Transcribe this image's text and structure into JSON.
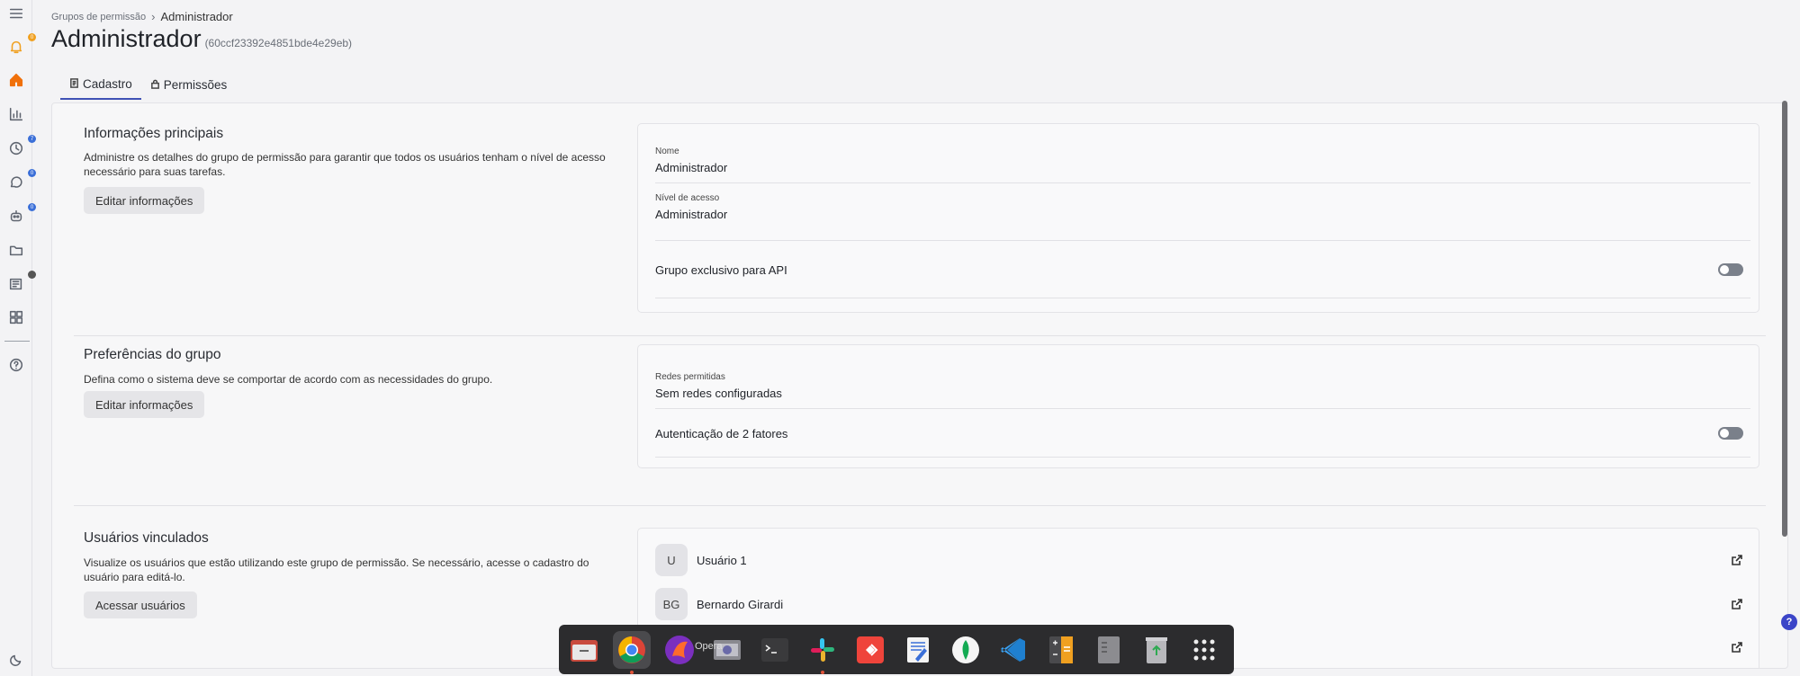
{
  "breadcrumb": {
    "parent": "Grupos de permissão",
    "current": "Administrador"
  },
  "page": {
    "title": "Administrador",
    "id": "(60ccf23392e4851bde4e29eb)"
  },
  "tabs": [
    {
      "label": "Cadastro",
      "icon": "document-icon",
      "active": true
    },
    {
      "label": "Permissões",
      "icon": "lock-icon",
      "active": false
    }
  ],
  "sections": {
    "main_info": {
      "title": "Informações principais",
      "description": "Administre os detalhes do grupo de permissão para garantir que todos os usuários tenham o nível de acesso necessário para suas tarefas.",
      "button": "Editar informações",
      "fields": {
        "name_label": "Nome",
        "name_value": "Administrador",
        "level_label": "Nível de acesso",
        "level_value": "Administrador",
        "api_label": "Grupo exclusivo para API",
        "api_enabled": false
      }
    },
    "preferences": {
      "title": "Preferências do grupo",
      "description": "Defina como o sistema deve se comportar de acordo com as necessidades do grupo.",
      "button": "Editar informações",
      "fields": {
        "networks_label": "Redes permitidas",
        "networks_value": "Sem redes configuradas",
        "twofa_label": "Autenticação de 2 fatores",
        "twofa_enabled": false
      }
    },
    "users": {
      "title": "Usuários vinculados",
      "description": "Visualize os usuários que estão utilizando este grupo de permissão. Se necessário, acesse o cadastro do usuário para editá-lo.",
      "button": "Acessar usuários",
      "list": [
        {
          "initials": "U",
          "name": "Usuário 1"
        },
        {
          "initials": "BG",
          "name": "Bernardo Girardi"
        }
      ]
    }
  },
  "sidebar_badges": {
    "notifications": "0",
    "history": "7",
    "chat": "0",
    "bot": "0"
  },
  "help_label": "?",
  "dock": {
    "apps": [
      "files-icon",
      "chrome-icon",
      "opera-icon",
      "video-icon",
      "terminal-icon",
      "slack-icon",
      "anydesk-icon",
      "text-editor-icon",
      "mongodb-icon",
      "vscode-icon",
      "calculator-icon",
      "archive-icon",
      "trash-icon",
      "app-grid-icon"
    ],
    "label": "Opera"
  },
  "colors": {
    "accent": "#3f51b5",
    "home": "#f0700a",
    "badge_orange": "#f0a020",
    "badge_blue": "#3b6fd8"
  }
}
